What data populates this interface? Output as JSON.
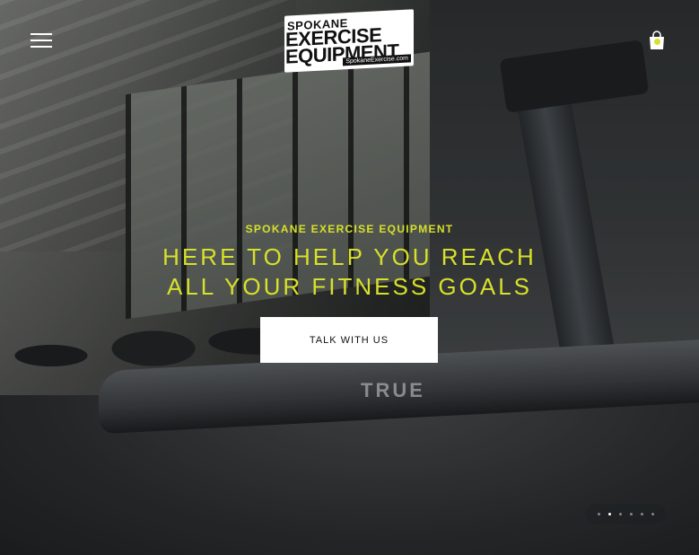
{
  "header": {
    "logo": {
      "line1": "SPOKANE",
      "line2": "EXERCISE",
      "line3": "EQUIPMENT",
      "url": "SpokaneExercise.com"
    },
    "menu_icon": "hamburger-menu-icon",
    "cart_icon": "shopping-bag-icon"
  },
  "hero": {
    "eyebrow": "SPOKANE EXERCISE EQUIPMENT",
    "headline": "HERE TO HELP YOU REACH ALL YOUR FITNESS GOALS",
    "cta_label": "TALK WITH US",
    "background_brand": "TRUE"
  },
  "slider": {
    "total_slides": 6,
    "active_index": 1
  },
  "colors": {
    "accent": "#d7e02a",
    "button_bg": "#ffffff",
    "text_dark": "#111111"
  }
}
